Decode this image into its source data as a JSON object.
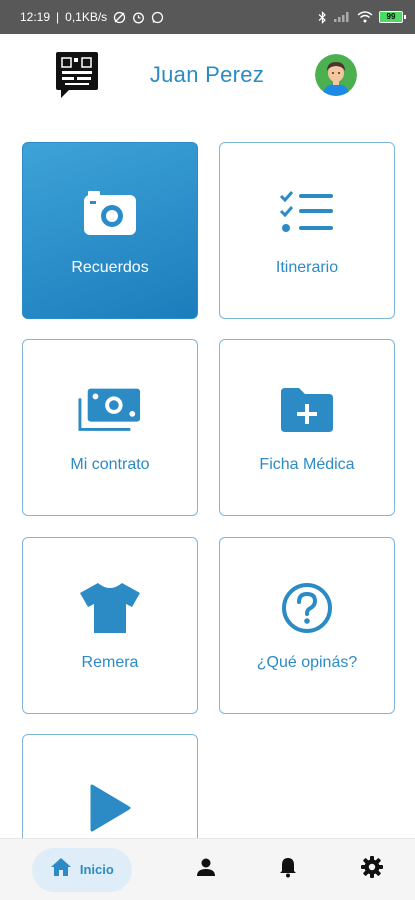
{
  "status_bar": {
    "time": "12:19",
    "network_speed": "0,1KB/s",
    "battery_level": "99"
  },
  "header": {
    "user_name": "Juan Perez"
  },
  "tiles": [
    {
      "label": "Recuerdos",
      "icon": "camera-icon",
      "active": true
    },
    {
      "label": "Itinerario",
      "icon": "checklist-icon",
      "active": false
    },
    {
      "label": "Mi contrato",
      "icon": "money-icon",
      "active": false
    },
    {
      "label": "Ficha Médica",
      "icon": "folder-plus-icon",
      "active": false
    },
    {
      "label": "Remera",
      "icon": "tshirt-icon",
      "active": false
    },
    {
      "label": "¿Qué opinás?",
      "icon": "question-circle-icon",
      "active": false
    },
    {
      "label": "",
      "icon": "play-icon",
      "active": false
    }
  ],
  "bottom_nav": {
    "items": [
      {
        "label": "Inicio",
        "icon": "home-icon",
        "active": true
      },
      {
        "label": "",
        "icon": "person-icon",
        "active": false
      },
      {
        "label": "",
        "icon": "bell-icon",
        "active": false
      },
      {
        "label": "",
        "icon": "gear-icon",
        "active": false
      }
    ]
  },
  "colors": {
    "accent": "#2c8bc4",
    "tile_border": "#7fb6d9",
    "status_bar": "#585858",
    "nav_active_bg": "#deedf7"
  }
}
